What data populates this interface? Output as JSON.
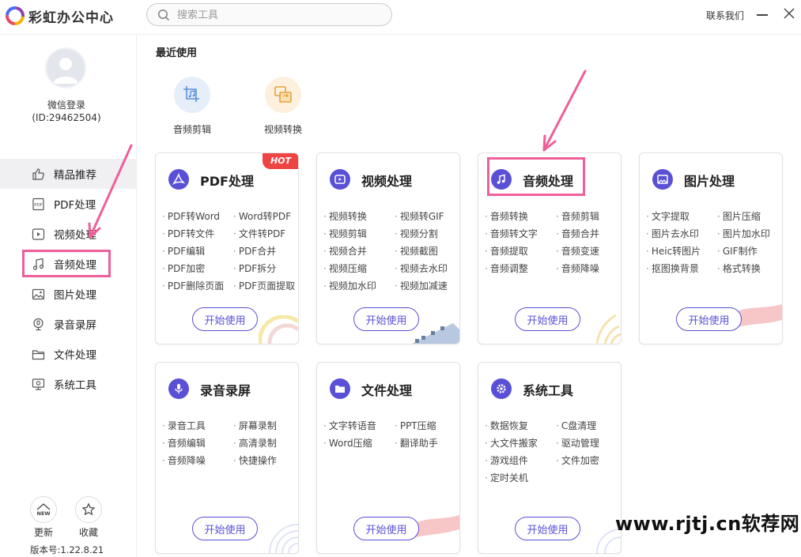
{
  "app": {
    "title": "彩虹办公中心"
  },
  "search": {
    "placeholder": "搜索工具"
  },
  "topbar": {
    "contact": "联系我们"
  },
  "user": {
    "login_label": "微信登录",
    "id_text": "(ID:29462504)"
  },
  "sidebar": {
    "items": [
      {
        "label": "精品推荐",
        "icon": "thumbs-up-icon"
      },
      {
        "label": "PDF处理",
        "icon": "pdf-icon"
      },
      {
        "label": "视频处理",
        "icon": "video-play-icon"
      },
      {
        "label": "音频处理",
        "icon": "music-note-icon"
      },
      {
        "label": "图片处理",
        "icon": "image-icon"
      },
      {
        "label": "录音录屏",
        "icon": "microphone-icon"
      },
      {
        "label": "文件处理",
        "icon": "folder-icon"
      },
      {
        "label": "系统工具",
        "icon": "monitor-icon"
      }
    ],
    "update_label": "更新",
    "update_badge": "NEW",
    "favorite_label": "收藏",
    "version": "版本号:1.22.8.21"
  },
  "recent": {
    "title": "最近使用",
    "items": [
      {
        "label": "音频剪辑",
        "icon": "audio-edit-icon"
      },
      {
        "label": "视频转换",
        "icon": "video-convert-icon"
      }
    ]
  },
  "cards": [
    {
      "title": "PDF处理",
      "badge": "HOT",
      "icon": "pdf-icon",
      "items": [
        "PDF转Word",
        "Word转PDF",
        "PDF转文件",
        "文件转PDF",
        "PDF编辑",
        "PDF合并",
        "PDF加密",
        "PDF拆分",
        "PDF删除页面",
        "PDF页面提取"
      ]
    },
    {
      "title": "视频处理",
      "icon": "video-play-icon",
      "items": [
        "视频转换",
        "视频转GIF",
        "视频剪辑",
        "视频分割",
        "视频合并",
        "视频截图",
        "视频压缩",
        "视频去水印",
        "视频加水印",
        "视频加减速"
      ]
    },
    {
      "title": "音频处理",
      "icon": "music-note-icon",
      "items": [
        "音频转换",
        "音频剪辑",
        "音频转文字",
        "音频合并",
        "音频提取",
        "音频变速",
        "音频调整",
        "音频降噪"
      ]
    },
    {
      "title": "图片处理",
      "icon": "image-icon",
      "items": [
        "文字提取",
        "图片压缩",
        "图片去水印",
        "图片加水印",
        "Heic转图片",
        "GIF制作",
        "抠图换背景",
        "格式转换"
      ]
    },
    {
      "title": "录音录屏",
      "icon": "microphone-icon",
      "items": [
        "录音工具",
        "屏幕录制",
        "音频编辑",
        "高清录制",
        "音频降噪",
        "快捷操作"
      ]
    },
    {
      "title": "文件处理",
      "icon": "folder-icon",
      "items": [
        "文字转语音",
        "PPT压缩",
        "Word压缩",
        "翻译助手"
      ]
    },
    {
      "title": "系统工具",
      "icon": "gear-icon",
      "items": [
        "数据恢复",
        "C盘清理",
        "大文件搬家",
        "驱动管理",
        "游戏组件",
        "文件加密",
        "定时关机"
      ]
    }
  ],
  "start_label": "开始使用",
  "watermark": "www.rjtj.cn软荐网",
  "colors": {
    "accent": "#5a50d6",
    "highlight": "#ef5f99",
    "hot": "#ee4444"
  }
}
